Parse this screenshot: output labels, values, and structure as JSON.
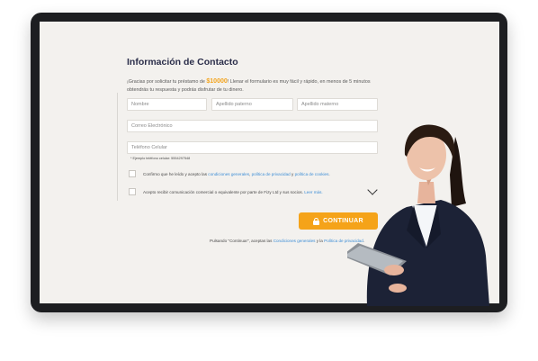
{
  "form": {
    "title": "Información de Contacto",
    "intro": {
      "before": "¡Gracias por solicitar tu préstamo de ",
      "amount": "$10000",
      "after": "! Llenar el formulario es muy fácil y rápido, en menos de 5 minutos obtendrás tu respuesta y podrás disfrutar de tu dinero."
    },
    "fields": {
      "nombre_placeholder": "Nombre",
      "apellido_paterno_placeholder": "Apellido paterno",
      "apellido_materno_placeholder": "Apellido materno",
      "correo_placeholder": "Correo Electrónico",
      "telefono_placeholder": "Teléfono Celular"
    },
    "phone_example": "* Ejemplo teléfono celular: 5554297548",
    "consent_terms": {
      "prefix": "Confirmo que he leído y acepto las ",
      "link1": "condiciones generales",
      "sep1": ", ",
      "link2": "política de privacidad",
      "sep2": " y ",
      "link3": "política de cookies",
      "suffix": "."
    },
    "consent_marketing": {
      "text": "Acepto recibir comunicación comercial o equivalente por parte de Fizy Ltd y sus socios. ",
      "link": "Leer más."
    },
    "cta_label": "CONTINUAR",
    "legal": {
      "prefix": "Pulsando \"Continuar\", aceptas las ",
      "link1": "Condiciones generales",
      "mid": " y la ",
      "link2": "Política de privacidad",
      "suffix": "."
    }
  },
  "icons": {
    "cta_icon": "lock-icon",
    "expand_icon": "chevron-down-icon"
  },
  "colors": {
    "accent": "#f5a319",
    "title": "#2b2e4a",
    "link": "#3d8ed6",
    "screen_background": "#f3f1ee",
    "device_frame": "#1d1e21"
  }
}
